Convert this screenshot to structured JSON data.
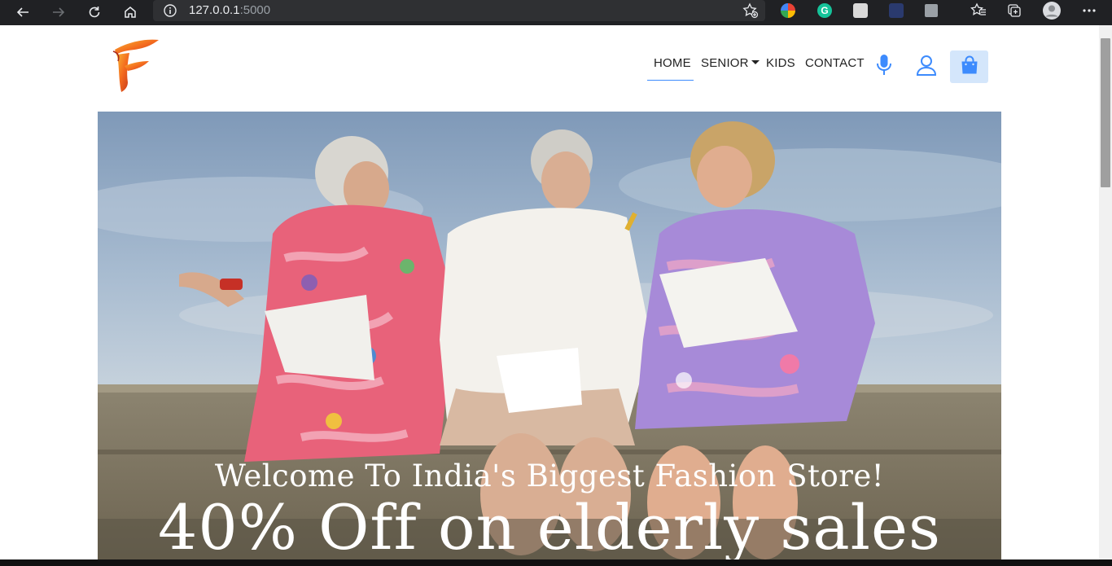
{
  "browser": {
    "url_host": "127.0.0.1",
    "url_port": ":5000"
  },
  "header": {
    "nav": {
      "home": "HOME",
      "senior": "SENIOR",
      "kids": "KIDS",
      "contact": "CONTACT"
    },
    "icons": [
      "microphone-icon",
      "user-icon",
      "shopping-bag-icon"
    ],
    "accent_color": "#3d8bfd",
    "cart_bg_color": "#d4e6fb"
  },
  "hero": {
    "welcome": "Welcome To India's Biggest  Fashion Store!",
    "offer": "40% Off on elderly sales"
  }
}
